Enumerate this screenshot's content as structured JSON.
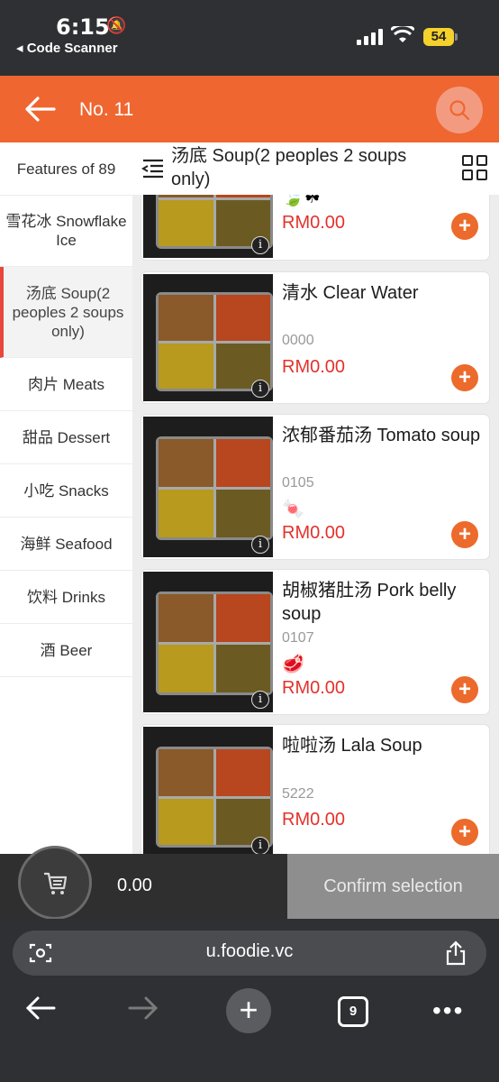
{
  "status_bar": {
    "time": "6:15",
    "back_app": "◂ Code Scanner",
    "battery": "54"
  },
  "header": {
    "title": "No. 11"
  },
  "sidebar": {
    "items": [
      {
        "label": "Features of 89"
      },
      {
        "label": "雪花冰 Snowflake Ice"
      },
      {
        "label": "汤底 Soup(2 peoples 2 soups only)",
        "active": true
      },
      {
        "label": "肉片 Meats"
      },
      {
        "label": "甜品 Dessert"
      },
      {
        "label": "小吃 Snacks"
      },
      {
        "label": "海鲜 Seafood"
      },
      {
        "label": "饮料 Drinks"
      },
      {
        "label": "酒 Beer"
      }
    ]
  },
  "category": {
    "title": "汤底 Soup(2 peoples 2 soups only)"
  },
  "products": [
    {
      "name": "",
      "code": "",
      "tag_icon": "🍃☘",
      "price": "RM0.00"
    },
    {
      "name": "清水 Clear Water",
      "code": "0000",
      "tag_icon": "",
      "price": "RM0.00"
    },
    {
      "name": "浓郁番茄汤 Tomato soup",
      "code": "0105",
      "tag_icon": "🍬",
      "price": "RM0.00"
    },
    {
      "name": "胡椒猪肚汤 Pork belly soup",
      "code": "0107",
      "tag_icon": "🥩",
      "price": "RM0.00"
    },
    {
      "name": "啦啦汤 Lala Soup",
      "code": "5222",
      "tag_icon": "",
      "price": "RM0.00"
    }
  ],
  "cart": {
    "total": "0.00",
    "confirm_label": "Confirm selection"
  },
  "browser": {
    "url": "u.foodie.vc",
    "tab_count": "9"
  },
  "colors": {
    "brand": "#ef6630",
    "price": "#e3322b",
    "active_marker": "#e8473b"
  }
}
